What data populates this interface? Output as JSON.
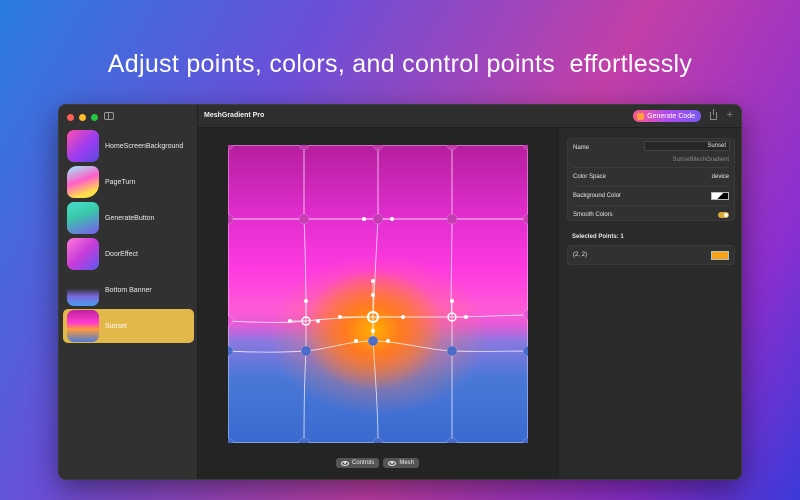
{
  "headline": "Adjust points, colors, and control points  effortlessly",
  "window": {
    "title": "MeshGradient Pro",
    "generate_label": "Generate Code"
  },
  "sidebar": {
    "items": [
      {
        "label": "HomeScreenBackground",
        "selected": false
      },
      {
        "label": "PageTurn",
        "selected": false
      },
      {
        "label": "GenerateButton",
        "selected": false
      },
      {
        "label": "DoorEffect",
        "selected": false
      },
      {
        "label": "Bottom Banner",
        "selected": false
      },
      {
        "label": "Sunset",
        "selected": true
      }
    ]
  },
  "canvas": {
    "controls_label": "Controls",
    "mesh_label": "Mesh"
  },
  "inspector": {
    "name_label": "Name",
    "name_value": "Sunset",
    "name_sub": "SunsetMeshGradient",
    "color_space_label": "Color Space",
    "color_space_value": "device",
    "background_color_label": "Background Color",
    "smooth_colors_label": "Smooth Colors",
    "smooth_colors_on": true,
    "selected_points_label": "Selected Points: 1",
    "selected_point": "(2, 2)",
    "selected_point_color": "#f7a21b"
  },
  "colors": {
    "accent": "#e2b84a",
    "generate_gradient": [
      "#ff5a8a",
      "#b04af0",
      "#7a5af0"
    ]
  }
}
